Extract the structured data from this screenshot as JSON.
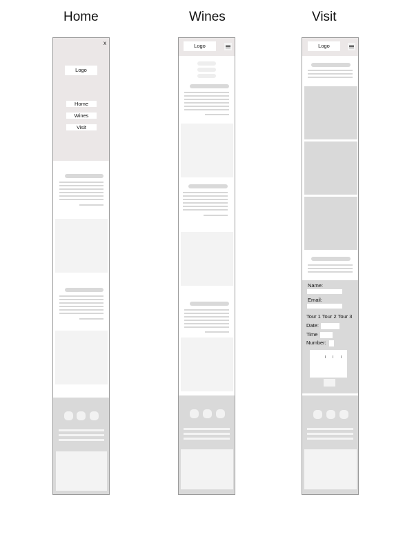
{
  "titles": {
    "home": "Home",
    "wines": "Wines",
    "visit": "Visit"
  },
  "home": {
    "close": "x",
    "logo": "Logo",
    "menu": [
      "Home",
      "Wines",
      "Visit"
    ]
  },
  "wines": {
    "logo": "Logo"
  },
  "visit": {
    "logo": "Logo",
    "form": {
      "name_label": "Name:",
      "email_label": "Email:",
      "tours": "Tour 1 Tour 2 Tour 3",
      "date_label": "Date:",
      "time_label": "Time",
      "number_label": "Number:"
    }
  }
}
